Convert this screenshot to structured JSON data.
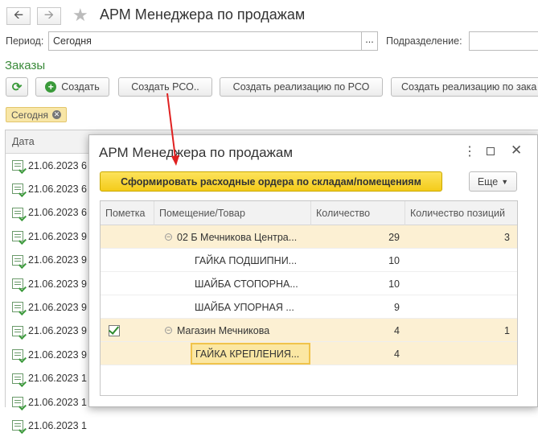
{
  "header": {
    "title": "АРМ Менеджера по продажам",
    "back_icon": "arrow-left-icon",
    "forward_icon": "arrow-right-icon",
    "favorite_icon": "star-icon"
  },
  "filters": {
    "period_label": "Период:",
    "period_value": "Сегодня",
    "period_select": "...",
    "subdivision_label": "Подразделение:",
    "subdivision_value": ""
  },
  "orders": {
    "title": "Заказы",
    "toolbar": {
      "refresh_icon": "refresh-icon",
      "create_label": "Создать",
      "create_rso_label": "Создать РСО..",
      "create_realization_rso_label": "Создать реализацию по РСО",
      "create_realization_order_label": "Создать реализацию по зака"
    },
    "filter_chip": "Сегодня",
    "column_date": "Дата",
    "rows": [
      {
        "date": "21.06.2023 6"
      },
      {
        "date": "21.06.2023 6"
      },
      {
        "date": "21.06.2023 6"
      },
      {
        "date": "21.06.2023 9"
      },
      {
        "date": "21.06.2023 9"
      },
      {
        "date": "21.06.2023 9"
      },
      {
        "date": "21.06.2023 9"
      },
      {
        "date": "21.06.2023 9"
      },
      {
        "date": "21.06.2023 9"
      },
      {
        "date": "21.06.2023 1"
      },
      {
        "date": "21.06.2023 1"
      },
      {
        "date": "21.06.2023 1"
      }
    ]
  },
  "dialog": {
    "title": "АРМ Менеджера по продажам",
    "menu_icon": "more-vertical-icon",
    "maximize_icon": "maximize-icon",
    "close_icon": "close-icon",
    "primary_button": "Сформировать расходные ордера по складам/помещениям",
    "more_button": "Еще",
    "columns": [
      "Пометка",
      "Помещение/Товар",
      "Количество",
      "Количество позиций"
    ],
    "rows": [
      {
        "mark": false,
        "name": "02 Б Мечникова Центра...",
        "qty": "29",
        "positions": "3",
        "group": true,
        "highlight": true
      },
      {
        "mark": false,
        "name": "ГАЙКА ПОДШИПНИ...",
        "qty": "10",
        "positions": "",
        "group": false,
        "highlight": false
      },
      {
        "mark": false,
        "name": "ШАЙБА СТОПОРНА...",
        "qty": "10",
        "positions": "",
        "group": false,
        "highlight": false
      },
      {
        "mark": false,
        "name": "ШАЙБА УПОРНАЯ ...",
        "qty": "9",
        "positions": "",
        "group": false,
        "highlight": false
      },
      {
        "mark": true,
        "name": "Магазин Мечникова",
        "qty": "4",
        "positions": "1",
        "group": true,
        "highlight": true
      },
      {
        "mark": false,
        "name": "ГАЙКА КРЕПЛЕНИЯ...",
        "qty": "4",
        "positions": "",
        "group": false,
        "highlight": true,
        "selected": true
      }
    ]
  },
  "colors": {
    "accent_green": "#3a8a3a",
    "yellow_button": "#f4cc1a",
    "row_highlight": "#fcf0d3",
    "annotation_arrow": "#e02020"
  }
}
